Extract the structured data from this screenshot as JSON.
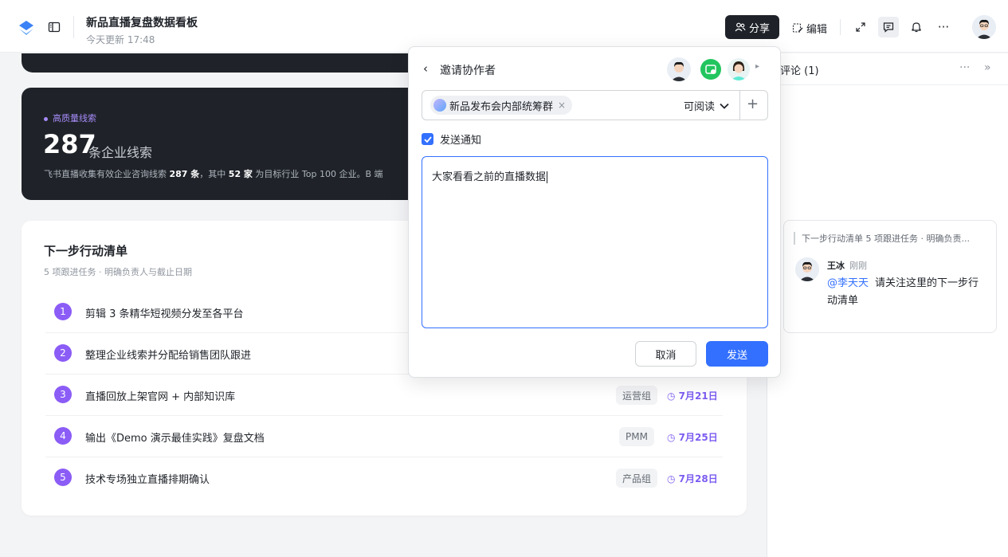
{
  "header": {
    "title": "新品直播复盘数据看板",
    "updated": "今天更新 17:48",
    "share_label": "分享",
    "edit_label": "编辑",
    "more_label": "···",
    "icons": [
      "sidebar-toggle-icon",
      "expand-icon",
      "comment-icon",
      "bell-icon",
      "more-icon"
    ]
  },
  "dark_card": {
    "tag": "高质量线索",
    "number": "287",
    "unit": "条企业线索",
    "desc_prefix": "飞书直播收集有效企业咨询线索 ",
    "desc_bold1": "287 条",
    "desc_mid": "，其中 ",
    "desc_bold2": "52 家",
    "desc_suffix": " 为目标行业 Top 100 企业。B 端"
  },
  "actions": {
    "title": "下一步行动清单",
    "subtitle": "5 项跟进任务 · 明确负责人与截止日期",
    "rows": [
      {
        "num": "1",
        "text": "剪辑 3 条精华短视频分发至各平台",
        "tag": "",
        "date": ""
      },
      {
        "num": "2",
        "text": "整理企业线索并分配给销售团队跟进",
        "tag": "",
        "date": ""
      },
      {
        "num": "3",
        "text": "直播回放上架官网 + 内部知识库",
        "tag": "运营组",
        "date": "7月21日"
      },
      {
        "num": "4",
        "text": "输出《Demo 演示最佳实践》复盘文档",
        "tag": "PMM",
        "date": "7月25日"
      },
      {
        "num": "5",
        "text": "技术专场独立直播排期确认",
        "tag": "产品组",
        "date": "7月28日"
      }
    ]
  },
  "comments": {
    "title": "评论 (1)",
    "more": "···",
    "collapse": "»",
    "quote": "下一步行动清单 5 项跟进任务 · 明确负责...",
    "author": "王冰",
    "time": "刚刚",
    "mention": "@李天天",
    "text": "请关注这里的下一步行动清单"
  },
  "invite_popup": {
    "back": "‹",
    "title": "邀请协作者",
    "chip_label": "新品发布会内部统筹群",
    "chip_remove": "×",
    "permission": "可阅读",
    "add": "+",
    "notify_label": "发送通知",
    "message": "大家看看之前的直播数据",
    "cancel_label": "取消",
    "send_label": "发送"
  },
  "colors": {
    "accent_blue": "#3370ff",
    "purple": "#8b5cf6",
    "dark_card": "#1f2329",
    "green_badge": "#22c55e"
  }
}
